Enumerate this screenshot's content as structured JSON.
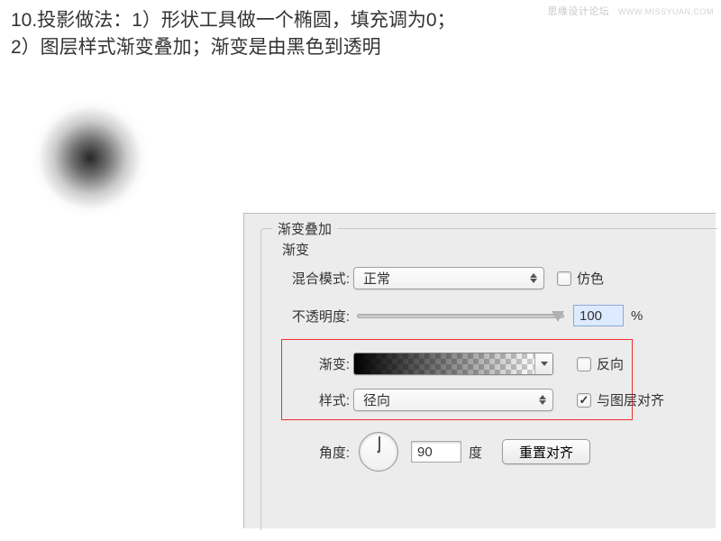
{
  "watermark": {
    "main": "思缘设计论坛",
    "sub": "WWW.MISSYUAN.COM"
  },
  "instructions_line1": "10.投影做法：1）形状工具做一个椭圆，填充调为0；",
  "instructions_line2": "2）图层样式渐变叠加；渐变是由黑色到透明",
  "panel": {
    "title": "渐变叠加",
    "subtitle": "渐变",
    "blend": {
      "label": "混合模式:",
      "value": "正常",
      "dither": "仿色"
    },
    "opacity": {
      "label": "不透明度:",
      "value": "100",
      "unit": "%"
    },
    "gradient": {
      "label": "渐变:",
      "reverse": "反向"
    },
    "style": {
      "label": "样式:",
      "value": "径向",
      "align": "与图层对齐"
    },
    "angle": {
      "label": "角度:",
      "value": "90",
      "unit": "度",
      "reset": "重置对齐"
    }
  }
}
